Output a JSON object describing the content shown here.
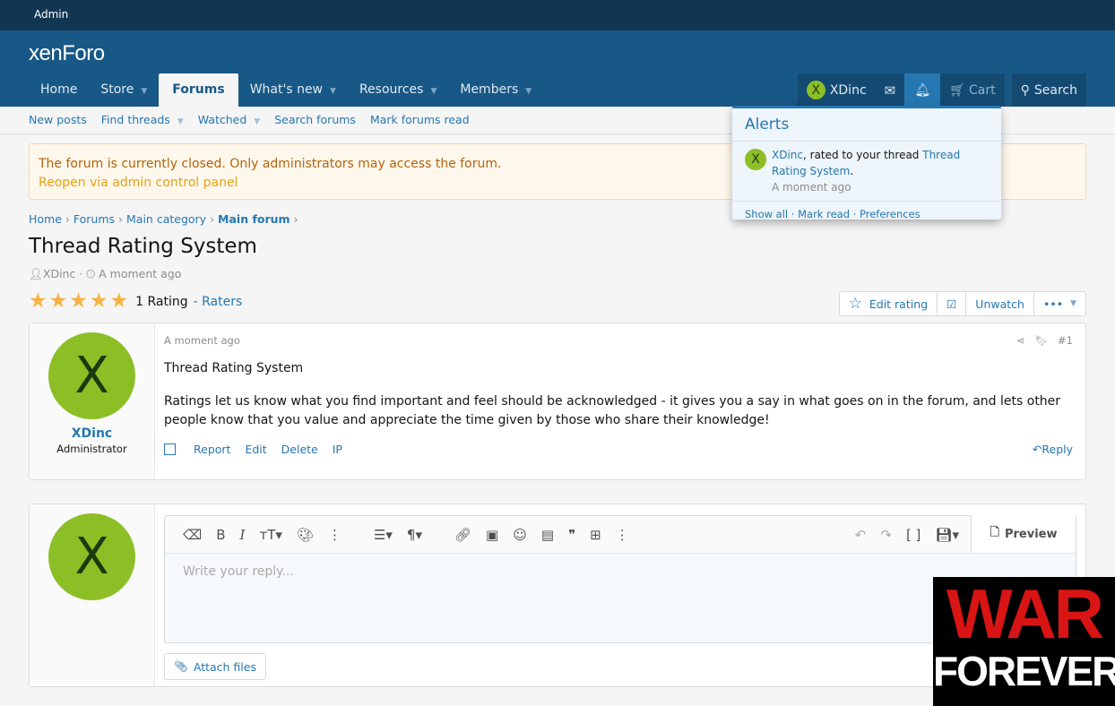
{
  "topbar": {
    "admin": "Admin"
  },
  "header": {
    "logo": "xenForo",
    "nav": [
      {
        "label": "Home"
      },
      {
        "label": "Store"
      },
      {
        "label": "Forums"
      },
      {
        "label": "What's new"
      },
      {
        "label": "Resources"
      },
      {
        "label": "Members"
      }
    ],
    "user": "XDinc",
    "avatar_letter": "X",
    "cart": "Cart",
    "search": "Search"
  },
  "subnav": [
    "New posts",
    "Find threads",
    "Watched",
    "Search forums",
    "Mark forums read"
  ],
  "notice": {
    "text": "The forum is currently closed. Only administrators may access the forum.",
    "link": "Reopen via admin control panel"
  },
  "breadcrumb": [
    "Home",
    "Forums",
    "Main category",
    "Main forum"
  ],
  "thread": {
    "title": "Thread Rating System",
    "author": "XDinc",
    "time": "A moment ago",
    "rating_count": "1 Rating",
    "raters": "Raters",
    "stars": 5
  },
  "thread_buttons": {
    "edit_rating": "Edit rating",
    "unwatch": "Unwatch",
    "more": "•••"
  },
  "post": {
    "time": "A moment ago",
    "number": "#1",
    "username": "XDinc",
    "role": "Administrator",
    "title": "Thread Rating System",
    "body": "Ratings let us know what you find important and feel should be acknowledged - it gives you a say in what goes on in the forum, and lets other people know that you value and appreciate the time given by those who share their knowledge!",
    "actions": [
      "Report",
      "Edit",
      "Delete",
      "IP"
    ],
    "reply": "Reply"
  },
  "editor": {
    "placeholder": "Write your reply...",
    "preview": "Preview",
    "attach": "Attach files"
  },
  "alerts": {
    "title": "Alerts",
    "user": "XDinc",
    "text": ", rated to your thread ",
    "thread": "Thread Rating System",
    "time": "A moment ago",
    "show_all": "Show all",
    "mark_read": "Mark read",
    "preferences": "Preferences"
  },
  "watermark": {
    "line1": "WAR",
    "line2": "FOREVER"
  }
}
